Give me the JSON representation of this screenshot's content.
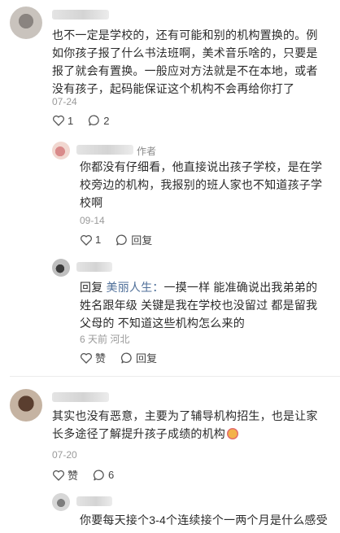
{
  "comments": [
    {
      "text": "也不一定是学校的，还有可能和别的机构置换的。例如你孩子报了什么书法班啊，美术音乐啥的，只要是报了就会有置换。一般应对方法就是不在本地，或者没有孩子，起码能保证这个机构不会再给你打了",
      "date": "07-24",
      "like_count": "1",
      "reply_count": "2",
      "replies": [
        {
          "author_tag": "作者",
          "text": "你都没有仔细看，他直接说出孩子学校，是在学校旁边的机构，我报别的班人家也不知道孩子学校啊",
          "date": "09-14",
          "like_count": "1",
          "reply_label": "回复"
        },
        {
          "reply_prefix": "回复",
          "reply_target": "美丽人生：",
          "text": "一摸一样 能准确说出我弟弟的姓名跟年级 关键是我在学校也没留过 都是留我父母的 不知道这些机构怎么来的",
          "date": "6 天前 河北",
          "like_label": "赞",
          "reply_label": "回复"
        }
      ]
    },
    {
      "text": "其实也没有恶意，主要为了辅导机构招生，也是让家长多途径了解提升孩子成绩的机构",
      "emoji": "emoji-face",
      "date": "07-20",
      "like_label": "赞",
      "reply_count": "6",
      "replies": [
        {
          "text": "你要每天接个3-4个连续接个一两个月是什么感受"
        }
      ]
    }
  ]
}
